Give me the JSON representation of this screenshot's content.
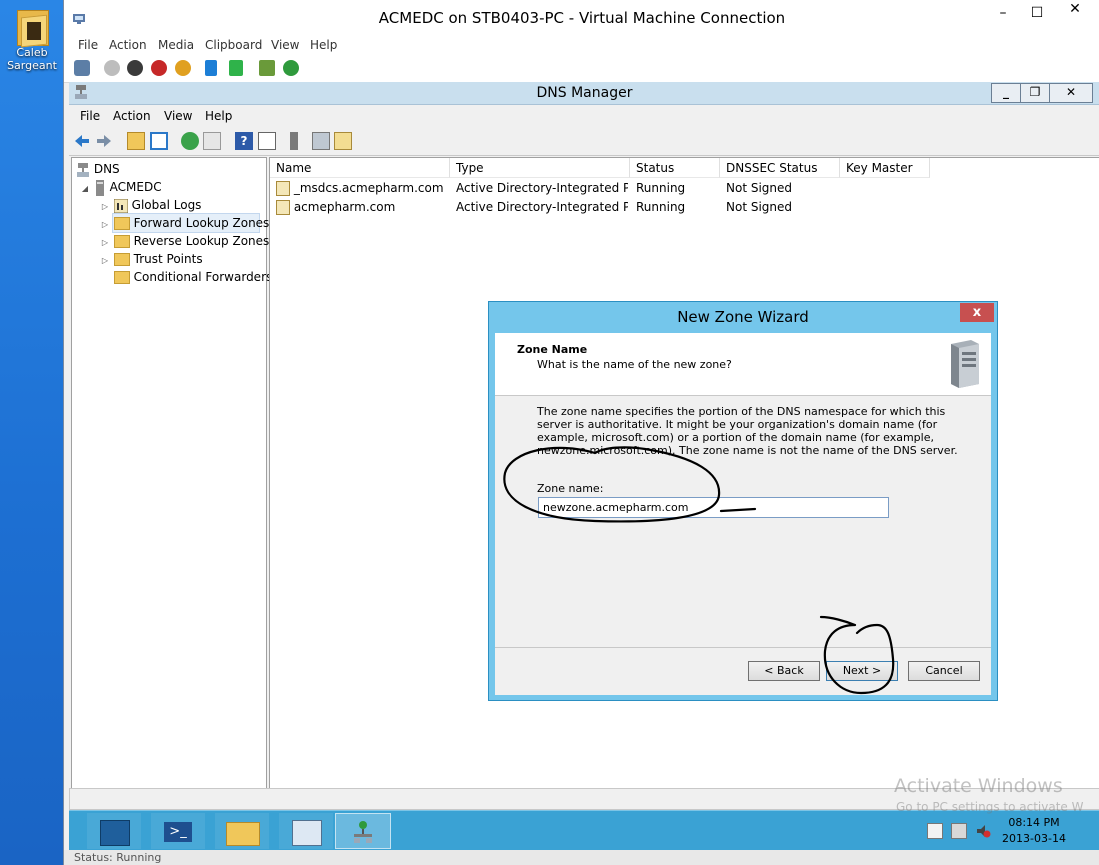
{
  "desktop": {
    "icon_label_line1": "Caleb",
    "icon_label_line2": "Sargeant"
  },
  "vm": {
    "title": "ACMEDC on STB0403-PC - Virtual Machine Connection",
    "menu": [
      "File",
      "Action",
      "Media",
      "Clipboard",
      "View",
      "Help"
    ],
    "minimize_glyph": "–",
    "restore_glyph": "☐",
    "close_glyph": "✕",
    "status": "Status: Running"
  },
  "dns": {
    "title": "DNS Manager",
    "menu": [
      "File",
      "Action",
      "View",
      "Help"
    ],
    "minimize_glyph": "_",
    "restore_glyph": "❐",
    "close_glyph": "✕",
    "tree": {
      "root": "DNS",
      "server": "ACMEDC",
      "items": [
        "Global Logs",
        "Forward Lookup Zones",
        "Reverse Lookup Zones",
        "Trust Points",
        "Conditional Forwarders"
      ]
    },
    "columns": [
      "Name",
      "Type",
      "Status",
      "DNSSEC Status",
      "Key Master"
    ],
    "rows": [
      {
        "name": "_msdcs.acmepharm.com",
        "type": "Active Directory-Integrated Pr...",
        "status": "Running",
        "dnssec": "Not Signed"
      },
      {
        "name": "acmepharm.com",
        "type": "Active Directory-Integrated Pr...",
        "status": "Running",
        "dnssec": "Not Signed"
      }
    ]
  },
  "wizard": {
    "title": "New Zone Wizard",
    "close_glyph": "x",
    "heading": "Zone Name",
    "subheading": "What is the name of the new zone?",
    "description": "The zone name specifies the portion of the DNS namespace for which this server is authoritative. It might be your organization's domain name (for example, microsoft.com) or a portion of the domain name (for example, newzone.microsoft.com). The zone name is not the name of the DNS server.",
    "zone_label": "Zone name:",
    "zone_value": "newzone.acmepharm.com",
    "back_label": "< Back",
    "next_label": "Next >",
    "cancel_label": "Cancel"
  },
  "taskbar": {
    "time": "08:14 PM",
    "date": "2013-03-14"
  },
  "watermark": {
    "line1": "Activate Windows",
    "line2": "Go to PC settings to activate W"
  },
  "colors": {
    "wizard_frame": "#74c6eb",
    "taskbar": "#3aa2d4",
    "desktop": "#1e73d6",
    "annotation": "#000000"
  }
}
